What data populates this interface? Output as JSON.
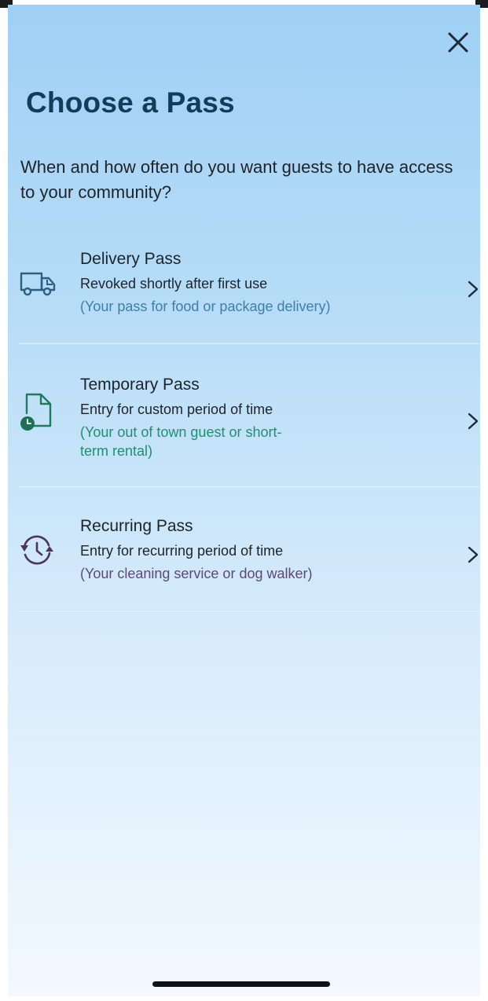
{
  "header": {
    "title": "Choose a Pass",
    "subtitle": "When and how often do you want guests to have access to your community?"
  },
  "passes": [
    {
      "title": "Delivery Pass",
      "description": "Revoked shortly after first use",
      "note": "(Your pass for food or package delivery)",
      "note_color": "#3f7fa6",
      "icon": "delivery-truck-icon"
    },
    {
      "title": "Temporary Pass",
      "description": "Entry for custom period of time",
      "note_line1": "(Your out of town guest or short-",
      "note_line2": "term rental)",
      "note_color": "#1f8f6f",
      "icon": "calendar-clock-icon"
    },
    {
      "title": "Recurring Pass",
      "description": "Entry for recurring period of time",
      "note": "(Your cleaning service or dog walker)",
      "note_color": "#5a4a78",
      "icon": "recurring-clock-icon"
    }
  ],
  "colors": {
    "title": "#0f3e59",
    "text": "#1e2328",
    "gradient_top": "#9fd0f5",
    "gradient_bottom": "#f3f9ff"
  }
}
